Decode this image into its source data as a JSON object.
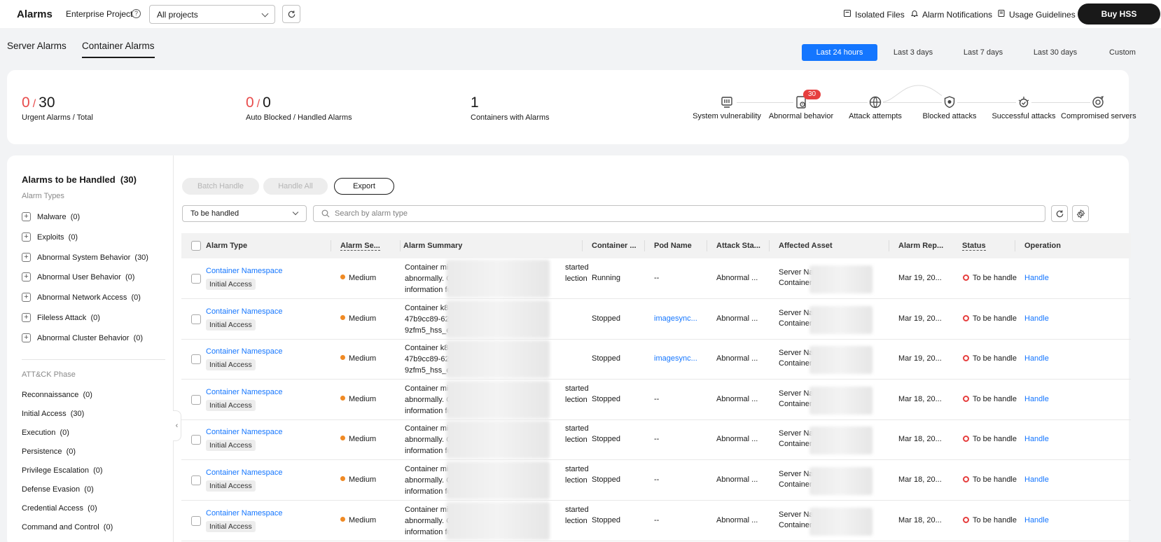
{
  "header": {
    "title": "Alarms",
    "enterprise_label": "Enterprise Project",
    "project_value": "All projects",
    "links": {
      "isolated": "Isolated Files",
      "notifications": "Alarm Notifications",
      "guidelines": "Usage Guidelines"
    },
    "buy": "Buy HSS"
  },
  "tabs": [
    "Server Alarms",
    "Container Alarms"
  ],
  "time_ranges": [
    "Last 24 hours",
    "Last 3 days",
    "Last 7 days",
    "Last 30 days",
    "Custom"
  ],
  "summary": {
    "urgent": "0",
    "total": "30",
    "urgent_label": "Urgent Alarms  / Total",
    "auto_blocked": "0",
    "handled": "0",
    "blocked_label": "Auto Blocked  / Handled Alarms",
    "containers": "1",
    "containers_label": "Containers with Alarms"
  },
  "chain": [
    {
      "label": "System vulnerability",
      "icon": "vulnerability-icon"
    },
    {
      "label": "Abnormal behavior",
      "icon": "abnormal-behavior-icon",
      "badge": "30"
    },
    {
      "label": "Attack attempts",
      "icon": "globe-attack-icon"
    },
    {
      "label": "Blocked attacks",
      "icon": "shield-icon"
    },
    {
      "label": "Successful attacks",
      "icon": "bug-icon"
    },
    {
      "label": "Compromised servers",
      "icon": "target-icon"
    }
  ],
  "panel": {
    "title": "Alarms to be Handled",
    "count": "(30)",
    "types_label": "Alarm Types",
    "types": [
      {
        "name": "Malware",
        "count": "(0)"
      },
      {
        "name": "Exploits",
        "count": "(0)"
      },
      {
        "name": "Abnormal System Behavior",
        "count": "(30)"
      },
      {
        "name": "Abnormal User Behavior",
        "count": "(0)"
      },
      {
        "name": "Abnormal Network Access",
        "count": "(0)"
      },
      {
        "name": "Fileless Attack",
        "count": "(0)"
      },
      {
        "name": "Abnormal Cluster Behavior",
        "count": "(0)"
      }
    ],
    "phase_label": "ATT&CK Phase",
    "phases": [
      {
        "name": "Reconnaissance",
        "count": "(0)"
      },
      {
        "name": "Initial Access",
        "count": "(30)"
      },
      {
        "name": "Execution",
        "count": "(0)"
      },
      {
        "name": "Persistence",
        "count": "(0)"
      },
      {
        "name": "Privilege Escalation",
        "count": "(0)"
      },
      {
        "name": "Defense Evasion",
        "count": "(0)"
      },
      {
        "name": "Credential Access",
        "count": "(0)"
      },
      {
        "name": "Command and Control",
        "count": "(0)"
      }
    ]
  },
  "toolbar": {
    "batch": "Batch Handle",
    "handle_all": "Handle All",
    "export": "Export",
    "status_filter": "To be handled",
    "search_placeholder": "Search by alarm type"
  },
  "table": {
    "columns": [
      "Alarm Type",
      "Alarm Se...",
      "Alarm Summary",
      "Container ...",
      "Pod Name",
      "Attack Sta...",
      "Affected Asset",
      "Alarm Rep...",
      "Status",
      "Operation"
    ],
    "rows": [
      {
        "type": "Container Namespace",
        "tag": "Initial Access",
        "severity": "Medium",
        "summary": [
          "Container mi",
          "started",
          "abnormally. C",
          "lection",
          "information fo",
          ""
        ],
        "container": "Running",
        "pod": "--",
        "attack": "Abnormal ...",
        "asset": [
          "Server Na",
          "Container"
        ],
        "time": "Mar 19, 20...",
        "status": "To be handle",
        "op": "Handle"
      },
      {
        "type": "Container Namespace",
        "tag": "Initial Access",
        "severity": "Medium",
        "summary": [
          "Container k8",
          "",
          "47b9cc89-62c",
          "",
          "9zfm5_hss_e",
          ""
        ],
        "container": "Stopped",
        "pod": "imagesync...",
        "attack": "Abnormal ...",
        "asset": [
          "Server Na",
          "Container"
        ],
        "time": "Mar 19, 20...",
        "status": "To be handle",
        "op": "Handle"
      },
      {
        "type": "Container Namespace",
        "tag": "Initial Access",
        "severity": "Medium",
        "summary": [
          "Container k8",
          "",
          "47b9cc89-62c",
          "",
          "9zfm5_hss_e",
          ""
        ],
        "container": "Stopped",
        "pod": "imagesync...",
        "attack": "Abnormal ...",
        "asset": [
          "Server Na",
          "Container"
        ],
        "time": "Mar 19, 20...",
        "status": "To be handle",
        "op": "Handle"
      },
      {
        "type": "Container Namespace",
        "tag": "Initial Access",
        "severity": "Medium",
        "summary": [
          "Container mi",
          "started",
          "abnormally. C",
          "lection",
          "information fo",
          ""
        ],
        "container": "Stopped",
        "pod": "--",
        "attack": "Abnormal ...",
        "asset": [
          "Server Na",
          "Container"
        ],
        "time": "Mar 18, 20...",
        "status": "To be handle",
        "op": "Handle"
      },
      {
        "type": "Container Namespace",
        "tag": "Initial Access",
        "severity": "Medium",
        "summary": [
          "Container mi",
          "started",
          "abnormally. C",
          "lection",
          "information fo",
          ""
        ],
        "container": "Stopped",
        "pod": "--",
        "attack": "Abnormal ...",
        "asset": [
          "Server Na",
          "Container"
        ],
        "time": "Mar 18, 20...",
        "status": "To be handle",
        "op": "Handle"
      },
      {
        "type": "Container Namespace",
        "tag": "Initial Access",
        "severity": "Medium",
        "summary": [
          "Container mi",
          "started",
          "abnormally. C",
          "lection",
          "information fo",
          ""
        ],
        "container": "Stopped",
        "pod": "--",
        "attack": "Abnormal ...",
        "asset": [
          "Server Na",
          "Container"
        ],
        "time": "Mar 18, 20...",
        "status": "To be handle",
        "op": "Handle"
      },
      {
        "type": "Container Namespace",
        "tag": "Initial Access",
        "severity": "Medium",
        "summary": [
          "Container mi",
          "started",
          "abnormally. C",
          "lection",
          "information fo",
          ""
        ],
        "container": "Stopped",
        "pod": "--",
        "attack": "Abnormal ...",
        "asset": [
          "Server Na",
          "Container"
        ],
        "time": "Mar 18, 20...",
        "status": "To be handle",
        "op": "Handle"
      }
    ]
  },
  "colors": {
    "accent": "#1476ff",
    "danger": "#e84b4b",
    "medium": "#f08a24"
  }
}
